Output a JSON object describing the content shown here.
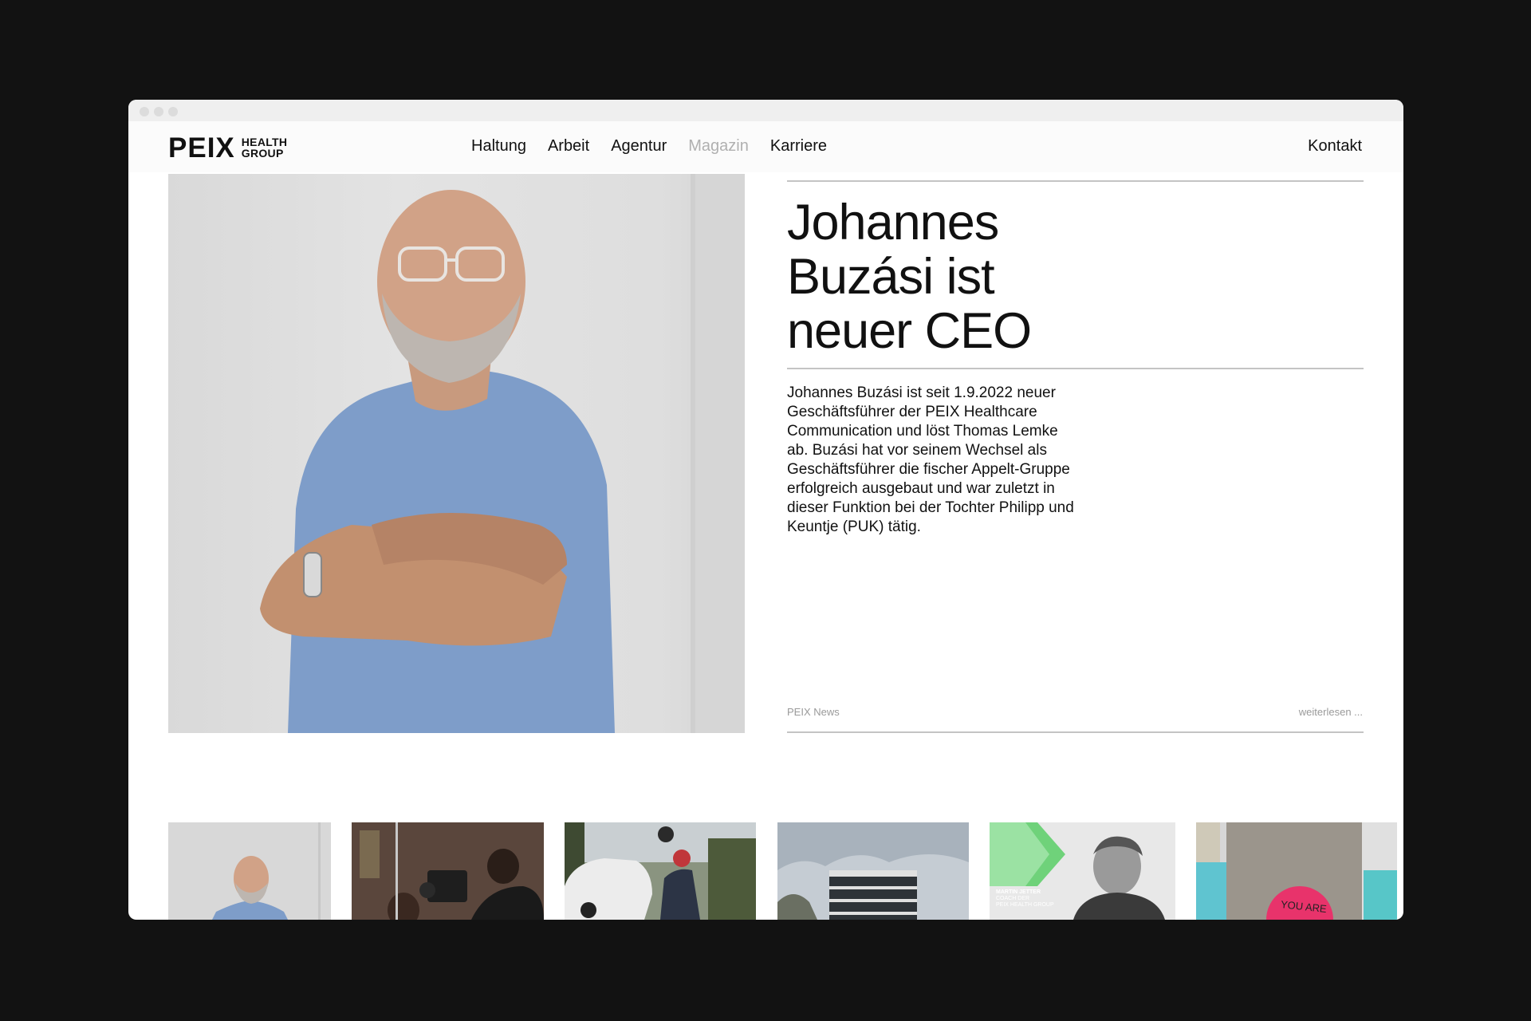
{
  "site": {
    "logo_main": "PEIX",
    "logo_sub_1": "HEALTH",
    "logo_sub_2": "GROUP"
  },
  "nav": {
    "items": [
      {
        "label": "Haltung",
        "active": false
      },
      {
        "label": "Arbeit",
        "active": false
      },
      {
        "label": "Agentur",
        "active": false
      },
      {
        "label": "Magazin",
        "active": true
      },
      {
        "label": "Karriere",
        "active": false
      }
    ],
    "contact": "Kontakt"
  },
  "article": {
    "title": "Johannes Buzási ist neuer CEO",
    "body": "Johannes Buzási ist seit 1.9.2022 neuer Geschäftsführer der PEIX Healthcare Communication und löst Thomas Lemke ab. Buzási hat vor seinem Wechsel als Geschäftsführer die fischer Appelt-Gruppe erfolgreich ausgebaut und war zuletzt in dieser Funktion bei der Tochter Philipp und Keuntje (PUK) tätig.",
    "category": "PEIX News",
    "read_more": "weiterlesen ..."
  },
  "thumbnails": {
    "coach_card": {
      "name": "MARTIN JETTER",
      "role_1": "COACH DER",
      "role_2": "PEIX HEALTH GROUP"
    },
    "sticker_text": "YOU ARE"
  },
  "colors": {
    "background": "#121212",
    "shirt_blue": "#7e9dc9",
    "nav_active": "#b0b0b0",
    "accent_green": "#6fd27a",
    "sticker_pink": "#e8336b"
  }
}
